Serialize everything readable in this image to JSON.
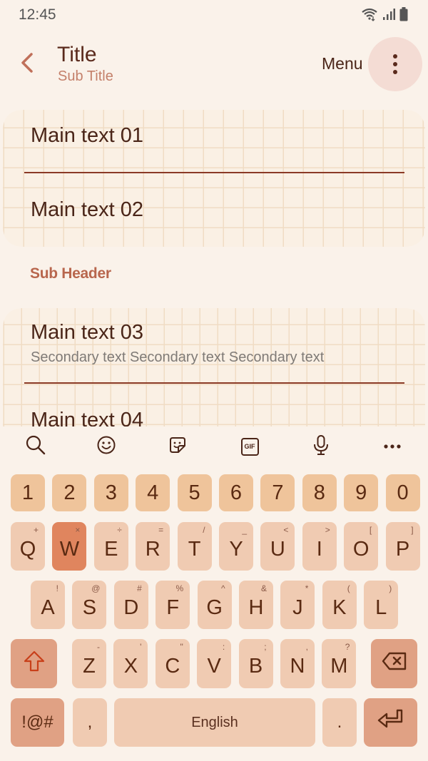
{
  "status_bar": {
    "time": "12:45",
    "icons": [
      "wifi-icon",
      "signal-icon",
      "battery-icon"
    ]
  },
  "app_bar": {
    "back_icon": "chevron-left-icon",
    "title": "Title",
    "subtitle": "Sub Title",
    "menu_label": "Menu",
    "more_icon": "more-vertical-icon"
  },
  "list_group_1": {
    "items": [
      {
        "main": "Main text 01"
      },
      {
        "main": "Main text 02"
      }
    ]
  },
  "sub_header": "Sub Header",
  "list_group_2": {
    "items": [
      {
        "main": "Main text 03",
        "secondary": "Secondary text Secondary text Secondary text"
      },
      {
        "main": "Main text 04"
      }
    ]
  },
  "keyboard": {
    "toolbar": [
      "search-icon",
      "emoji-icon",
      "sticker-icon",
      "gif-icon",
      "microphone-icon",
      "more-horizontal-icon"
    ],
    "gif_label": "GIF",
    "number_row": [
      "1",
      "2",
      "3",
      "4",
      "5",
      "6",
      "7",
      "8",
      "9",
      "0"
    ],
    "row1": [
      {
        "key": "Q",
        "hint": "+"
      },
      {
        "key": "W",
        "hint": "×"
      },
      {
        "key": "E",
        "hint": "÷"
      },
      {
        "key": "R",
        "hint": "="
      },
      {
        "key": "T",
        "hint": "/"
      },
      {
        "key": "Y",
        "hint": "_"
      },
      {
        "key": "U",
        "hint": "<"
      },
      {
        "key": "I",
        "hint": ">"
      },
      {
        "key": "O",
        "hint": "["
      },
      {
        "key": "P",
        "hint": "]"
      }
    ],
    "row2": [
      {
        "key": "A",
        "hint": "!"
      },
      {
        "key": "S",
        "hint": "@"
      },
      {
        "key": "D",
        "hint": "#"
      },
      {
        "key": "F",
        "hint": "%"
      },
      {
        "key": "G",
        "hint": "^"
      },
      {
        "key": "H",
        "hint": "&"
      },
      {
        "key": "J",
        "hint": "*"
      },
      {
        "key": "K",
        "hint": "("
      },
      {
        "key": "L",
        "hint": ")"
      }
    ],
    "row3": [
      {
        "key": "Z",
        "hint": "-"
      },
      {
        "key": "X",
        "hint": "'"
      },
      {
        "key": "C",
        "hint": "\""
      },
      {
        "key": "V",
        "hint": ":"
      },
      {
        "key": "B",
        "hint": ";"
      },
      {
        "key": "N",
        "hint": ","
      },
      {
        "key": "M",
        "hint": "?"
      }
    ],
    "active_key": "W",
    "shift_icon": "shift-icon",
    "backspace_icon": "backspace-icon",
    "symbols_label": "!@#",
    "comma_label": ",",
    "space_label": "English",
    "period_label": ".",
    "enter_icon": "enter-icon"
  },
  "colors": {
    "background": "#faf2ea",
    "accent": "#b8664d",
    "number_key": "#efc49b",
    "letter_key": "#f0cbb2",
    "active_key": "#e0855e",
    "function_key": "#e0a184",
    "divider": "#8b3a26",
    "grid_line": "#f0dcc4"
  }
}
